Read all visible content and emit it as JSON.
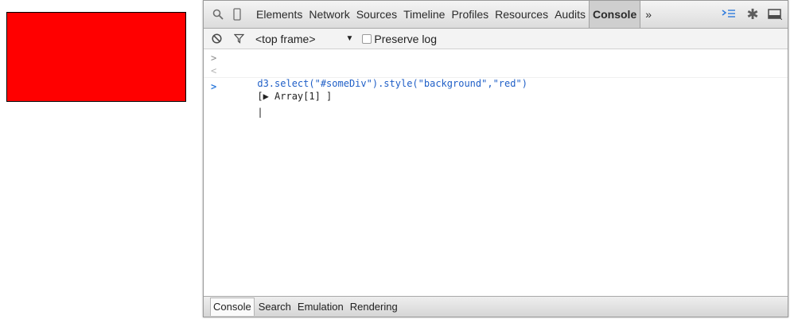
{
  "toolbar": {
    "icons": [
      "search-icon",
      "mobile-device-icon",
      "console-drawer-icon",
      "gear-icon",
      "dock-icon"
    ],
    "tabs": [
      "Elements",
      "Network",
      "Sources",
      "Timeline",
      "Profiles",
      "Resources",
      "Audits",
      "Console"
    ],
    "overflow_label": "»",
    "selected_tab": "Console"
  },
  "console_bar": {
    "frame_select": "<top frame>",
    "frame_arrow": "▼",
    "preserve_log_label": "Preserve log"
  },
  "console": {
    "input_line": "d3.select(\"#someDiv\").style(\"background\",\"red\")",
    "input_prompt": ">",
    "result_prompt": "<",
    "result_line": "[▶ Array[1] ]",
    "active_prompt": ">",
    "cursor": "|"
  },
  "bottom_tabs": [
    "Console",
    "Search",
    "Emulation",
    "Rendering"
  ],
  "colors": {
    "box": "#ff0000",
    "command": "#1f5fc7",
    "prompt_blue": "#2f7bdc"
  }
}
